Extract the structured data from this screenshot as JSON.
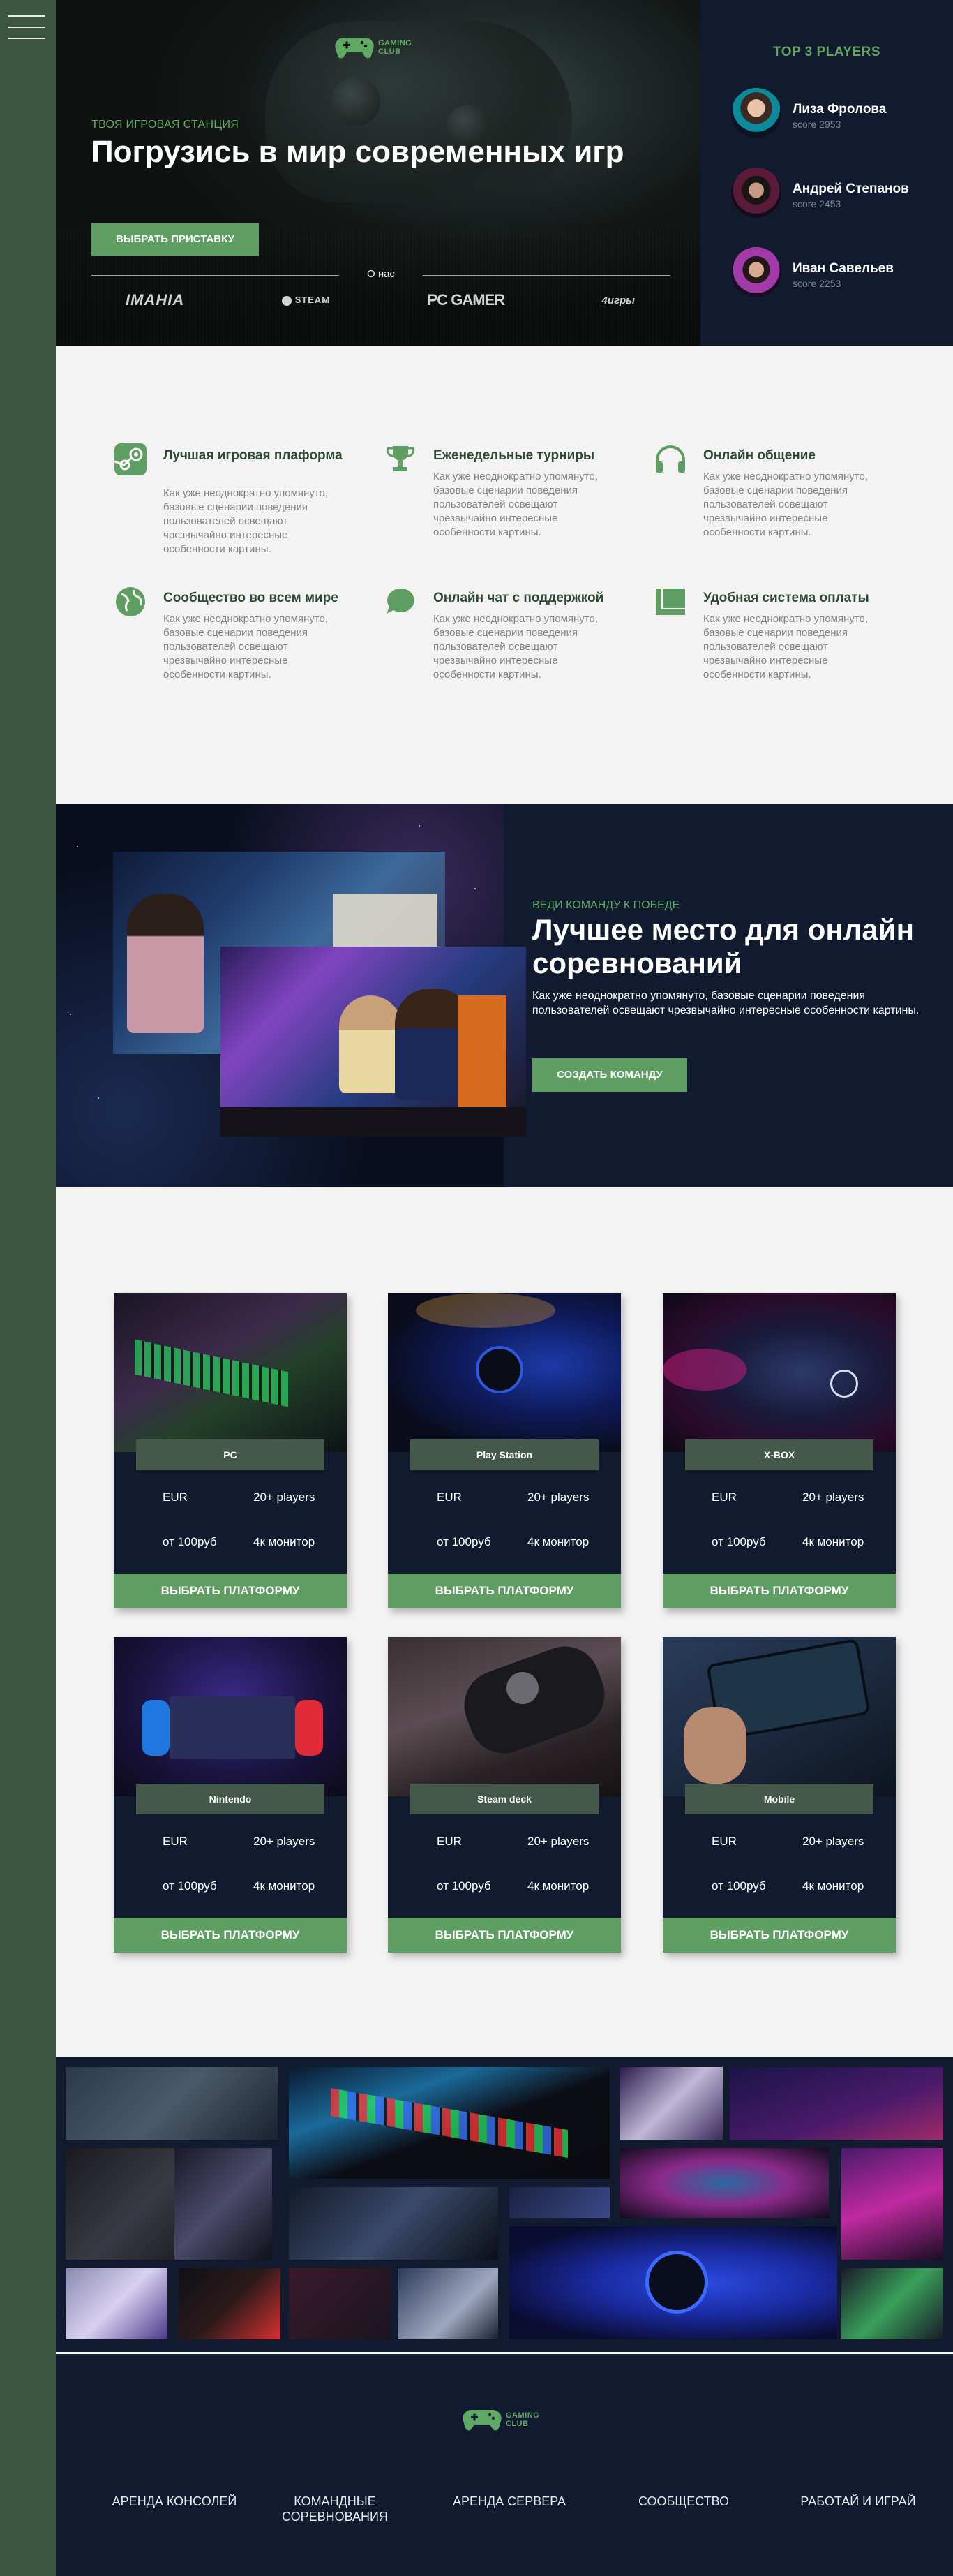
{
  "colors": {
    "rail": "#3b5540",
    "accent_green": "#5e9e62",
    "navy": "#111a2e",
    "feature_title": "#2f4a33"
  },
  "nav": {
    "menu_icon": "hamburger-icon"
  },
  "logo": {
    "line1": "GAMING",
    "line2": "CLUB",
    "icon": "gamepad-icon"
  },
  "hero": {
    "kicker": "ТВОЯ ИГРОВАЯ СТАНЦИЯ",
    "title": "Погрузись в мир современных игр",
    "button": "ВЫБРАТЬ ПРИСТАВКУ",
    "about_label": "О нас",
    "partners": [
      "IMAHIA",
      "STEAM",
      "PC GAMER",
      "4игры"
    ]
  },
  "top_players": {
    "title": "TOP 3 PLAYERS",
    "players": [
      {
        "name": "Лиза Фролова",
        "score": "score 2953"
      },
      {
        "name": "Андрей Степанов",
        "score": "score 2453"
      },
      {
        "name": "Иван Савельев",
        "score": "score 2253"
      }
    ]
  },
  "features": [
    {
      "icon": "steam-icon",
      "title": "Лучшая игровая плаформа",
      "text": "Как уже неоднократно упомянуто, базовые сценарии поведения пользователей освещают чрезвычайно интересные особенности картины."
    },
    {
      "icon": "trophy-icon",
      "title": "Еженедельные турниры",
      "text": "Как уже неоднократно упомянуто, базовые сценарии поведения пользователей освещают чрезвычайно интересные особенности картины."
    },
    {
      "icon": "headphones-icon",
      "title": "Онлайн общение",
      "text": "Как уже неоднократно упомянуто, базовые сценарии поведения пользователей освещают чрезвычайно интересные особенности картины."
    },
    {
      "icon": "globe-icon",
      "title": "Сообщество во всем мире",
      "text": "Как уже неоднократно упомянуто, базовые сценарии поведения пользователей освещают чрезвычайно интересные особенности картины."
    },
    {
      "icon": "chat-icon",
      "title": "Онлайн чат с поддержкой",
      "text": "Как уже неоднократно упомянуто, базовые сценарии поведения пользователей освещают чрезвычайно интересные особенности картины."
    },
    {
      "icon": "payment-icon",
      "title": "Удобная система оплаты",
      "text": "Как уже неоднократно упомянуто, базовые сценарии поведения пользователей освещают чрезвычайно интересные особенности картины."
    }
  ],
  "best_place": {
    "kicker": "ВЕДИ КОМАНДУ К ПОБЕДЕ",
    "title": "Лучшее место для онлайн соревнований",
    "text": "Как уже неоднократно упомянуто, базовые сценарии поведения пользователей освещают чрезвычайно интересные особенности картины.",
    "button": "СОЗДАТЬ КОМАНДУ"
  },
  "platforms": [
    {
      "name": "PC",
      "currency": "EUR",
      "players": "20+ players",
      "price": "от 100руб",
      "monitor": "4к монитор",
      "button": "ВЫБРАТЬ ПЛАТФОРМУ"
    },
    {
      "name": "Play Station",
      "currency": "EUR",
      "players": "20+ players",
      "price": "от 100руб",
      "monitor": "4к монитор",
      "button": "ВЫБРАТЬ ПЛАТФОРМУ"
    },
    {
      "name": "X-BOX",
      "currency": "EUR",
      "players": "20+ players",
      "price": "от 100руб",
      "monitor": "4к монитор",
      "button": "ВЫБРАТЬ ПЛАТФОРМУ"
    },
    {
      "name": "Nintendo",
      "currency": "EUR",
      "players": "20+ players",
      "price": "от 100руб",
      "monitor": "4к монитор",
      "button": "ВЫБРАТЬ ПЛАТФОРМУ"
    },
    {
      "name": "Steam deck",
      "currency": "EUR",
      "players": "20+ players",
      "price": "от 100руб",
      "monitor": "4к монитор",
      "button": "ВЫБРАТЬ ПЛАТФОРМУ"
    },
    {
      "name": "Mobile",
      "currency": "EUR",
      "players": "20+ players",
      "price": "от 100руб",
      "monitor": "4к монитор",
      "button": "ВЫБРАТЬ ПЛАТФОРМУ"
    }
  ],
  "footer": {
    "links": [
      "АРЕНДА КОНСОЛЕЙ",
      "КОМАНДНЫЕ СОРЕВНОВАНИЯ",
      "АРЕНДА СЕРВЕРА",
      "СООБЩЕСТВО",
      "РАБОТАЙ И ИГРАЙ"
    ]
  }
}
